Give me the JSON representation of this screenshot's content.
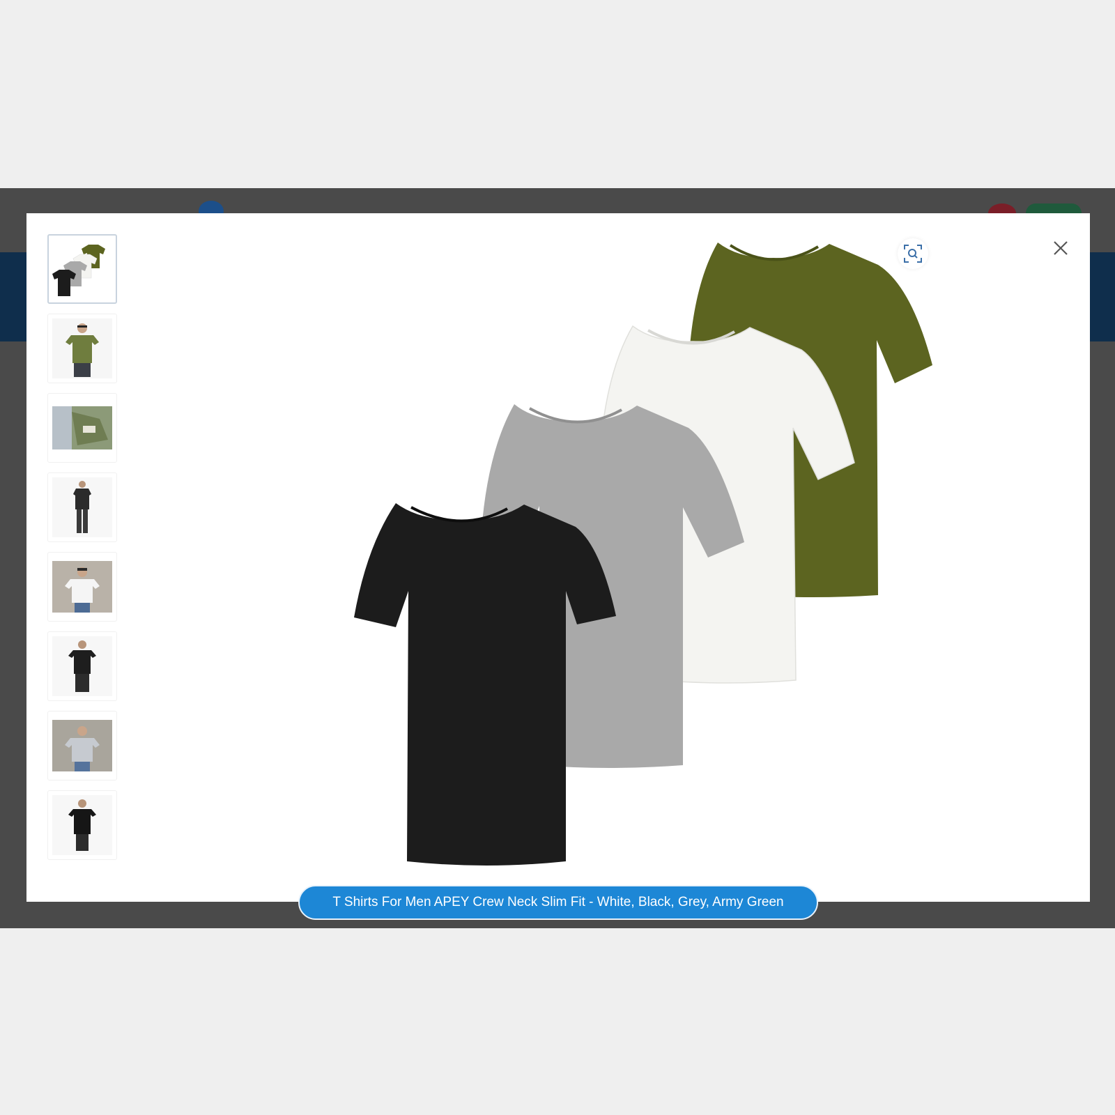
{
  "product": {
    "title": "T Shirts For Men APEY Crew Neck Slim Fit - White, Black, Grey, Army Green"
  },
  "viewer": {
    "zoom_icon": "zoom-focus-icon",
    "close_icon": "close-icon",
    "thumbnails": [
      {
        "name": "thumb-4-pack",
        "active": true
      },
      {
        "name": "thumb-green-model"
      },
      {
        "name": "thumb-fabric-closeup"
      },
      {
        "name": "thumb-dark-full-outfit"
      },
      {
        "name": "thumb-white-model"
      },
      {
        "name": "thumb-black-model"
      },
      {
        "name": "thumb-grey-model"
      },
      {
        "name": "thumb-black-model-2"
      }
    ]
  },
  "colors": {
    "caption_bg": "#1d87d6",
    "shirt_black": "#1c1c1c",
    "shirt_grey": "#a9a9a9",
    "shirt_white": "#f4f4f1",
    "shirt_green": "#5c6420"
  }
}
